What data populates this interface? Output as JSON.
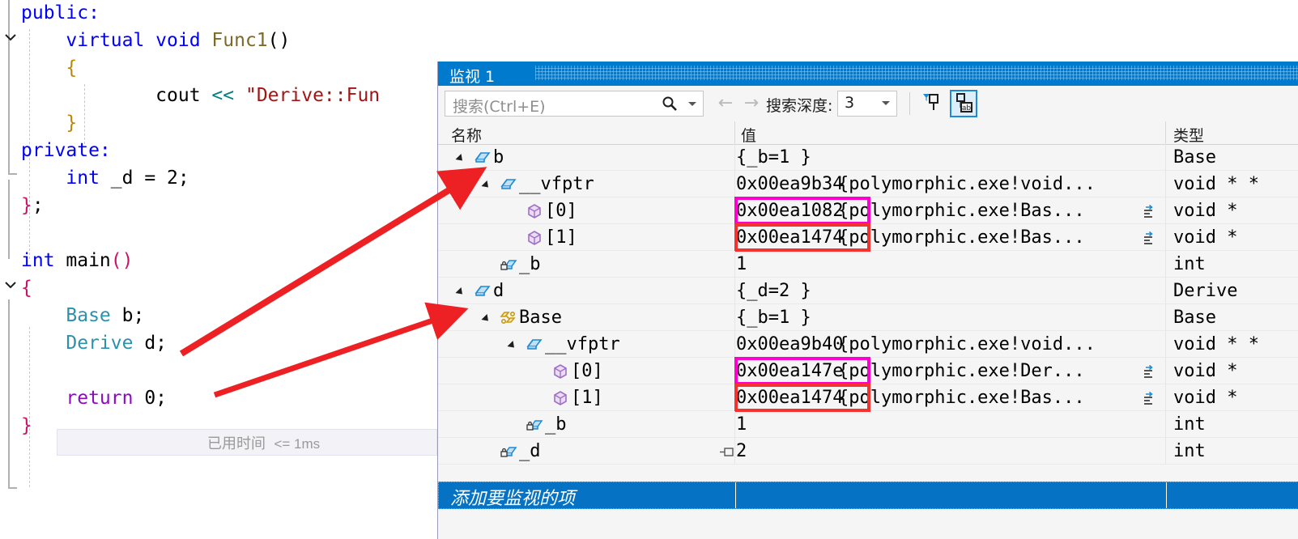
{
  "editor": {
    "lines": [
      {
        "indent": 0,
        "segments": [
          {
            "t": "public:",
            "c": "kw"
          }
        ]
      },
      {
        "indent": 0,
        "segments": [
          {
            "t": "    ",
            "c": "plain"
          },
          {
            "t": "virtual void ",
            "c": "kw"
          },
          {
            "t": "Func1",
            "c": "fn"
          },
          {
            "t": "()",
            "c": "plain"
          }
        ]
      },
      {
        "indent": 0,
        "segments": [
          {
            "t": "    ",
            "c": "plain"
          },
          {
            "t": "{",
            "c": "brace-gold"
          }
        ]
      },
      {
        "indent": 0,
        "segments": [
          {
            "t": "            ",
            "c": "plain"
          },
          {
            "t": "cout ",
            "c": "plain"
          },
          {
            "t": "<<",
            "c": "op"
          },
          {
            "t": " ",
            "c": "plain"
          },
          {
            "t": "\"Derive::Fun",
            "c": "str"
          }
        ]
      },
      {
        "indent": 0,
        "segments": [
          {
            "t": "    ",
            "c": "plain"
          },
          {
            "t": "}",
            "c": "brace-gold"
          }
        ]
      },
      {
        "indent": 0,
        "segments": [
          {
            "t": "private:",
            "c": "kw"
          }
        ]
      },
      {
        "indent": 0,
        "segments": [
          {
            "t": "    ",
            "c": "plain"
          },
          {
            "t": "int",
            "c": "kw"
          },
          {
            "t": " _d = 2;",
            "c": "plain"
          }
        ]
      },
      {
        "indent": 0,
        "segments": [
          {
            "t": "}",
            "c": "brace-pink"
          },
          {
            "t": ";",
            "c": "plain"
          }
        ]
      },
      {
        "indent": 0,
        "segments": []
      },
      {
        "indent": 0,
        "segments": [
          {
            "t": "int",
            "c": "kw"
          },
          {
            "t": " main",
            "c": "plain"
          },
          {
            "t": "()",
            "c": "brace-pink"
          }
        ]
      },
      {
        "indent": 0,
        "segments": [
          {
            "t": "{",
            "c": "brace-pink"
          }
        ]
      },
      {
        "indent": 0,
        "segments": [
          {
            "t": "    ",
            "c": "plain"
          },
          {
            "t": "Base",
            "c": "typ"
          },
          {
            "t": " b;",
            "c": "plain"
          }
        ]
      },
      {
        "indent": 0,
        "segments": [
          {
            "t": "    ",
            "c": "plain"
          },
          {
            "t": "Derive",
            "c": "typ"
          },
          {
            "t": " d;",
            "c": "plain"
          }
        ]
      },
      {
        "indent": 0,
        "segments": []
      },
      {
        "indent": 0,
        "segments": [
          {
            "t": "    ",
            "c": "plain"
          },
          {
            "t": "return",
            "c": "ret"
          },
          {
            "t": " 0;",
            "c": "plain"
          }
        ]
      },
      {
        "indent": 0,
        "segments": [
          {
            "t": "}",
            "c": "brace-pink"
          }
        ]
      }
    ],
    "inline_hint": {
      "label": "已用时间",
      "value": "<= 1ms"
    }
  },
  "watch": {
    "title": "监视 1",
    "toolbar": {
      "search_placeholder": "搜索(Ctrl+E)",
      "search_value": "",
      "back_arrow": "←",
      "forward_arrow": "→",
      "depth_label": "搜索深度:",
      "depth_value": "3",
      "pin_filter_icon": "pin-filter-icon",
      "pin_label_icon": "pin-label-icon"
    },
    "columns": [
      "名称",
      "值",
      "类型"
    ],
    "rows": [
      {
        "depth": 0,
        "expander": "expanded",
        "icon": "object-box-icon",
        "name": "b",
        "value": "{_b=1 }",
        "value2": "",
        "type": "Base"
      },
      {
        "depth": 1,
        "expander": "expanded",
        "icon": "object-box-icon",
        "name": "__vfptr",
        "value": "0x00ea9b34",
        "value2": "{polymorphic.exe!void...",
        "type": "void * *"
      },
      {
        "depth": 2,
        "expander": "none",
        "icon": "array-cube-icon",
        "name": "[0]",
        "value": "0x00ea1082",
        "value2": "{polymorphic.exe!Bas...",
        "type": "void *",
        "refresh": true,
        "highlight": "magenta"
      },
      {
        "depth": 2,
        "expander": "none",
        "icon": "array-cube-icon",
        "name": "[1]",
        "value": "0x00ea1474",
        "value2": "{polymorphic.exe!Bas...",
        "type": "void *",
        "refresh": true,
        "highlight": "red"
      },
      {
        "depth": 1,
        "expander": "none",
        "icon": "private-field-icon",
        "name": "_b",
        "value": "1",
        "value2": "",
        "type": "int"
      },
      {
        "depth": 0,
        "expander": "expanded",
        "icon": "object-box-icon",
        "name": "d",
        "value": "{_d=2 }",
        "value2": "",
        "type": "Derive"
      },
      {
        "depth": 1,
        "expander": "expanded",
        "icon": "base-class-icon",
        "name": "Base",
        "value": "{_b=1 }",
        "value2": "",
        "type": "Base"
      },
      {
        "depth": 2,
        "expander": "expanded",
        "icon": "object-box-icon",
        "name": "__vfptr",
        "value": "0x00ea9b40",
        "value2": "{polymorphic.exe!void...",
        "type": "void * *"
      },
      {
        "depth": 3,
        "expander": "none",
        "icon": "array-cube-icon",
        "name": "[0]",
        "value": "0x00ea147e",
        "value2": "{polymorphic.exe!Der...",
        "type": "void *",
        "refresh": true,
        "highlight": "magenta"
      },
      {
        "depth": 3,
        "expander": "none",
        "icon": "array-cube-icon",
        "name": "[1]",
        "value": "0x00ea1474",
        "value2": "{polymorphic.exe!Bas...",
        "type": "void *",
        "refresh": true,
        "highlight": "red"
      },
      {
        "depth": 2,
        "expander": "none",
        "icon": "private-field-icon",
        "name": "_b",
        "value": "1",
        "value2": "",
        "type": "int"
      },
      {
        "depth": 1,
        "expander": "none",
        "icon": "private-field-icon",
        "name": "_d",
        "value": "2",
        "value2": "",
        "type": "int",
        "expandmark": true
      }
    ],
    "add_row_text": "添加要监视的项"
  },
  "annotations": {
    "arrow_color": "#ed2024",
    "highlight_magenta": "#ff00d0",
    "highlight_red": "#f5322f"
  }
}
